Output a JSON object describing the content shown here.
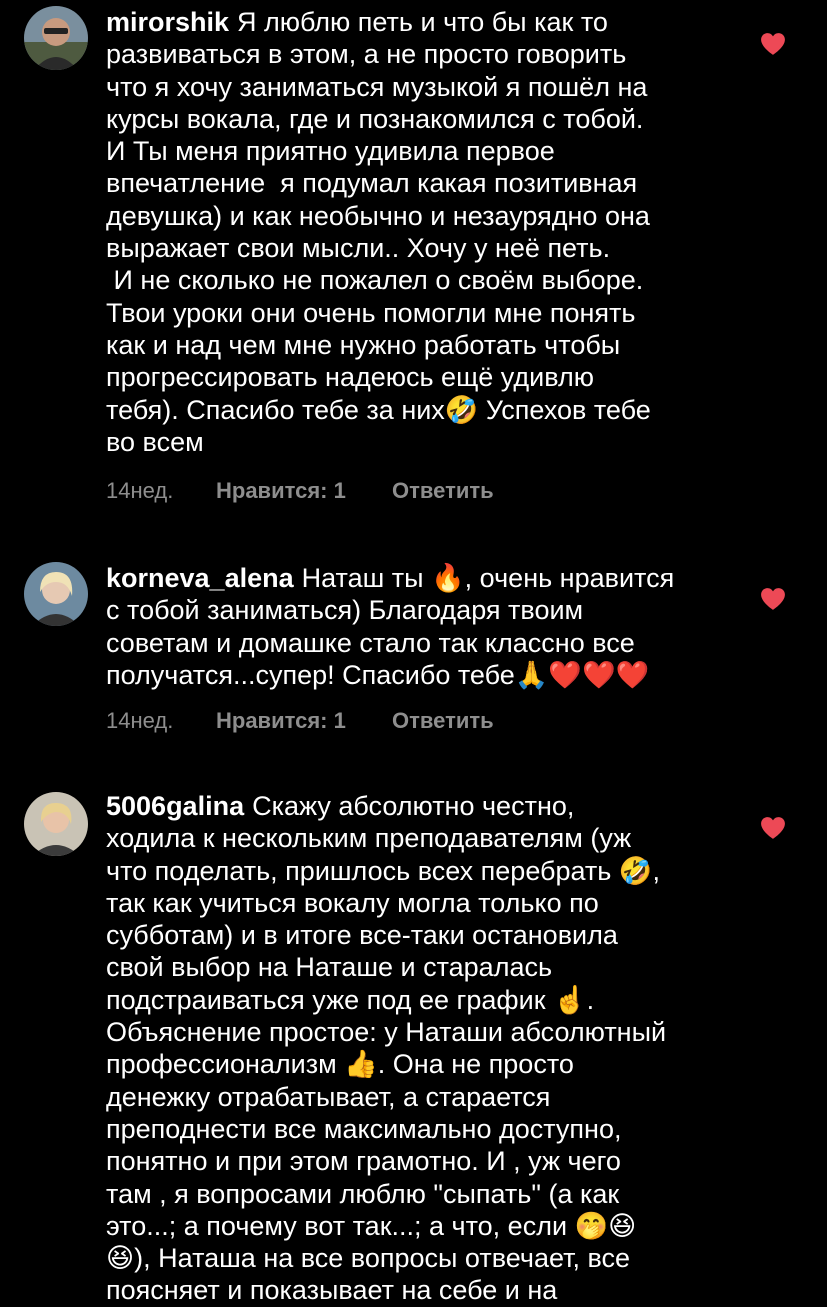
{
  "comments": [
    {
      "username": "mirorshik",
      "text": "Я люблю петь и что бы как то\nразвиваться в этом, а не просто говорить\nчто я хочу заниматься музыкой я пошёл на\nкурсы вокала, где и познакомился с тобой.\nИ Ты меня приятно удивила первое\nвпечатление  я подумал какая позитивная\nдевушка) и как необычно и незаурядно она\nвыражает свои мысли.. Хочу у неё петь.\n И не сколько не пожалел о своём выборе.\nТвои уроки они очень помогли мне понять\nкак и над чем мне нужно работать чтобы\nпрогрессировать надеюсь ещё удивлю\nтебя). Спасибо тебе за них🤣 Успехов тебе\nво всем",
      "time": "14нед.",
      "likes": "Нравится: 1",
      "reply": "Ответить"
    },
    {
      "username": "korneva_alena",
      "text": "Наташ ты 🔥, очень нравится\nс тобой заниматься) Благодаря твоим\nсоветам и домашке стало так классно все\nполучатся...супер! Спасибо тебе🙏❤️❤️❤️",
      "time": "14нед.",
      "likes": "Нравится: 1",
      "reply": "Ответить"
    },
    {
      "username": "5006galina",
      "text": "Скажу абсолютно честно,\nходила к нескольким преподавателям (уж\nчто поделать, пришлось всех перебрать 🤣,\nтак как учиться вокалу могла только по\nсубботам) и в итоге все-таки остановила\nсвой выбор на Наташе и старалась\nподстраиваться уже под ее график ☝️.\nОбъяснение простое: у Наташи абсолютный\nпрофессионализм 👍. Она не просто\nденежку отрабатывает, а старается\nпреподнести все максимально доступно,\nпонятно и при этом грамотно. И , уж чего\nтам , я вопросами люблю \"сыпать\" (а как\nэто...; а почему вот так...; а что, если 🤭😆\n😆), Наташа на все вопросы отвечает, все\nпоясняет и показывает на себе и на"
    }
  ],
  "colors": {
    "background": "#000000",
    "heart": "#ed4956",
    "meta": "#8e8e8e"
  }
}
